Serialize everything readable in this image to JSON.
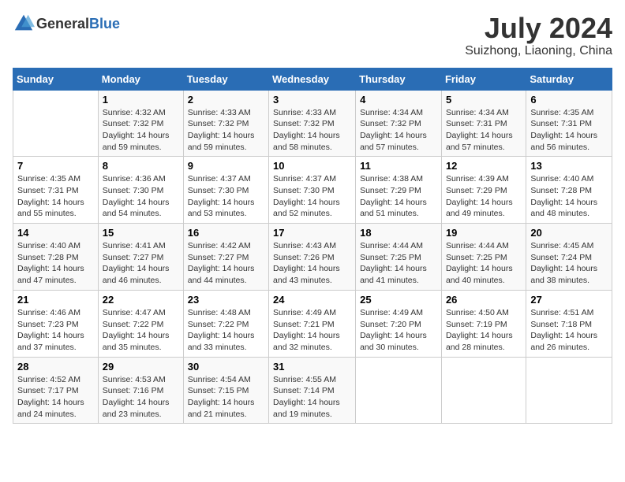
{
  "header": {
    "logo_general": "General",
    "logo_blue": "Blue",
    "month_title": "July 2024",
    "location": "Suizhong, Liaoning, China"
  },
  "days_of_week": [
    "Sunday",
    "Monday",
    "Tuesday",
    "Wednesday",
    "Thursday",
    "Friday",
    "Saturday"
  ],
  "weeks": [
    [
      {
        "day": "",
        "info": ""
      },
      {
        "day": "1",
        "info": "Sunrise: 4:32 AM\nSunset: 7:32 PM\nDaylight: 14 hours\nand 59 minutes."
      },
      {
        "day": "2",
        "info": "Sunrise: 4:33 AM\nSunset: 7:32 PM\nDaylight: 14 hours\nand 59 minutes."
      },
      {
        "day": "3",
        "info": "Sunrise: 4:33 AM\nSunset: 7:32 PM\nDaylight: 14 hours\nand 58 minutes."
      },
      {
        "day": "4",
        "info": "Sunrise: 4:34 AM\nSunset: 7:32 PM\nDaylight: 14 hours\nand 57 minutes."
      },
      {
        "day": "5",
        "info": "Sunrise: 4:34 AM\nSunset: 7:31 PM\nDaylight: 14 hours\nand 57 minutes."
      },
      {
        "day": "6",
        "info": "Sunrise: 4:35 AM\nSunset: 7:31 PM\nDaylight: 14 hours\nand 56 minutes."
      }
    ],
    [
      {
        "day": "7",
        "info": "Sunrise: 4:35 AM\nSunset: 7:31 PM\nDaylight: 14 hours\nand 55 minutes."
      },
      {
        "day": "8",
        "info": "Sunrise: 4:36 AM\nSunset: 7:30 PM\nDaylight: 14 hours\nand 54 minutes."
      },
      {
        "day": "9",
        "info": "Sunrise: 4:37 AM\nSunset: 7:30 PM\nDaylight: 14 hours\nand 53 minutes."
      },
      {
        "day": "10",
        "info": "Sunrise: 4:37 AM\nSunset: 7:30 PM\nDaylight: 14 hours\nand 52 minutes."
      },
      {
        "day": "11",
        "info": "Sunrise: 4:38 AM\nSunset: 7:29 PM\nDaylight: 14 hours\nand 51 minutes."
      },
      {
        "day": "12",
        "info": "Sunrise: 4:39 AM\nSunset: 7:29 PM\nDaylight: 14 hours\nand 49 minutes."
      },
      {
        "day": "13",
        "info": "Sunrise: 4:40 AM\nSunset: 7:28 PM\nDaylight: 14 hours\nand 48 minutes."
      }
    ],
    [
      {
        "day": "14",
        "info": "Sunrise: 4:40 AM\nSunset: 7:28 PM\nDaylight: 14 hours\nand 47 minutes."
      },
      {
        "day": "15",
        "info": "Sunrise: 4:41 AM\nSunset: 7:27 PM\nDaylight: 14 hours\nand 46 minutes."
      },
      {
        "day": "16",
        "info": "Sunrise: 4:42 AM\nSunset: 7:27 PM\nDaylight: 14 hours\nand 44 minutes."
      },
      {
        "day": "17",
        "info": "Sunrise: 4:43 AM\nSunset: 7:26 PM\nDaylight: 14 hours\nand 43 minutes."
      },
      {
        "day": "18",
        "info": "Sunrise: 4:44 AM\nSunset: 7:25 PM\nDaylight: 14 hours\nand 41 minutes."
      },
      {
        "day": "19",
        "info": "Sunrise: 4:44 AM\nSunset: 7:25 PM\nDaylight: 14 hours\nand 40 minutes."
      },
      {
        "day": "20",
        "info": "Sunrise: 4:45 AM\nSunset: 7:24 PM\nDaylight: 14 hours\nand 38 minutes."
      }
    ],
    [
      {
        "day": "21",
        "info": "Sunrise: 4:46 AM\nSunset: 7:23 PM\nDaylight: 14 hours\nand 37 minutes."
      },
      {
        "day": "22",
        "info": "Sunrise: 4:47 AM\nSunset: 7:22 PM\nDaylight: 14 hours\nand 35 minutes."
      },
      {
        "day": "23",
        "info": "Sunrise: 4:48 AM\nSunset: 7:22 PM\nDaylight: 14 hours\nand 33 minutes."
      },
      {
        "day": "24",
        "info": "Sunrise: 4:49 AM\nSunset: 7:21 PM\nDaylight: 14 hours\nand 32 minutes."
      },
      {
        "day": "25",
        "info": "Sunrise: 4:49 AM\nSunset: 7:20 PM\nDaylight: 14 hours\nand 30 minutes."
      },
      {
        "day": "26",
        "info": "Sunrise: 4:50 AM\nSunset: 7:19 PM\nDaylight: 14 hours\nand 28 minutes."
      },
      {
        "day": "27",
        "info": "Sunrise: 4:51 AM\nSunset: 7:18 PM\nDaylight: 14 hours\nand 26 minutes."
      }
    ],
    [
      {
        "day": "28",
        "info": "Sunrise: 4:52 AM\nSunset: 7:17 PM\nDaylight: 14 hours\nand 24 minutes."
      },
      {
        "day": "29",
        "info": "Sunrise: 4:53 AM\nSunset: 7:16 PM\nDaylight: 14 hours\nand 23 minutes."
      },
      {
        "day": "30",
        "info": "Sunrise: 4:54 AM\nSunset: 7:15 PM\nDaylight: 14 hours\nand 21 minutes."
      },
      {
        "day": "31",
        "info": "Sunrise: 4:55 AM\nSunset: 7:14 PM\nDaylight: 14 hours\nand 19 minutes."
      },
      {
        "day": "",
        "info": ""
      },
      {
        "day": "",
        "info": ""
      },
      {
        "day": "",
        "info": ""
      }
    ]
  ]
}
